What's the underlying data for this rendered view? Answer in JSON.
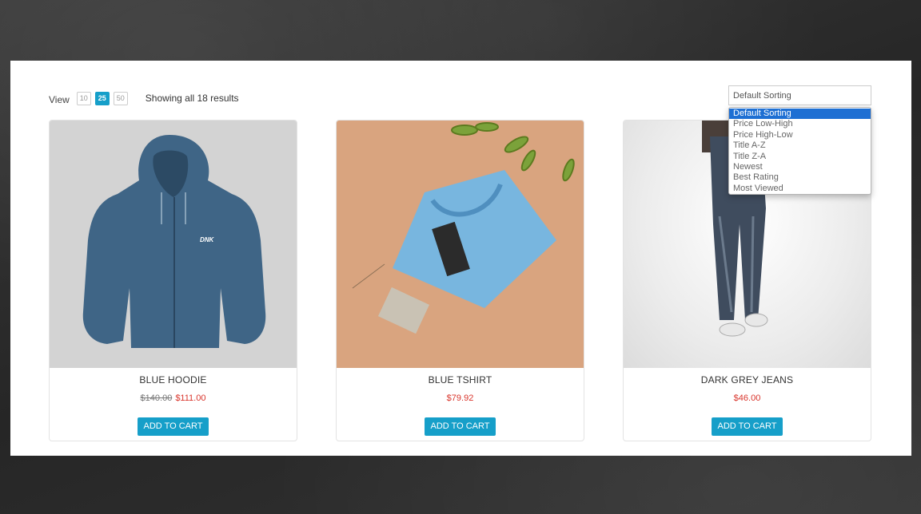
{
  "toolbar": {
    "view_label": "View",
    "per_page": [
      "10",
      "25",
      "50"
    ],
    "active_per_page": "25",
    "results_text": "Showing all 18 results"
  },
  "sorting": {
    "selected": "Default Sorting",
    "options": [
      "Default Sorting",
      "Price Low-High",
      "Price High-Low",
      "Title A-Z",
      "Title Z-A",
      "Newest",
      "Best Rating",
      "Most Viewed"
    ]
  },
  "products": [
    {
      "name": "BLUE HOODIE",
      "old_price": "$140.00",
      "price": "$111.00",
      "button": "ADD TO CART"
    },
    {
      "name": "BLUE TSHIRT",
      "old_price": "",
      "price": "$79.92",
      "button": "ADD TO CART"
    },
    {
      "name": "DARK GREY JEANS",
      "old_price": "",
      "price": "$46.00",
      "button": "ADD TO CART"
    }
  ],
  "colors": {
    "accent": "#169fc9",
    "sale": "#d9342b",
    "dropdown_highlight": "#1e6fd3"
  }
}
